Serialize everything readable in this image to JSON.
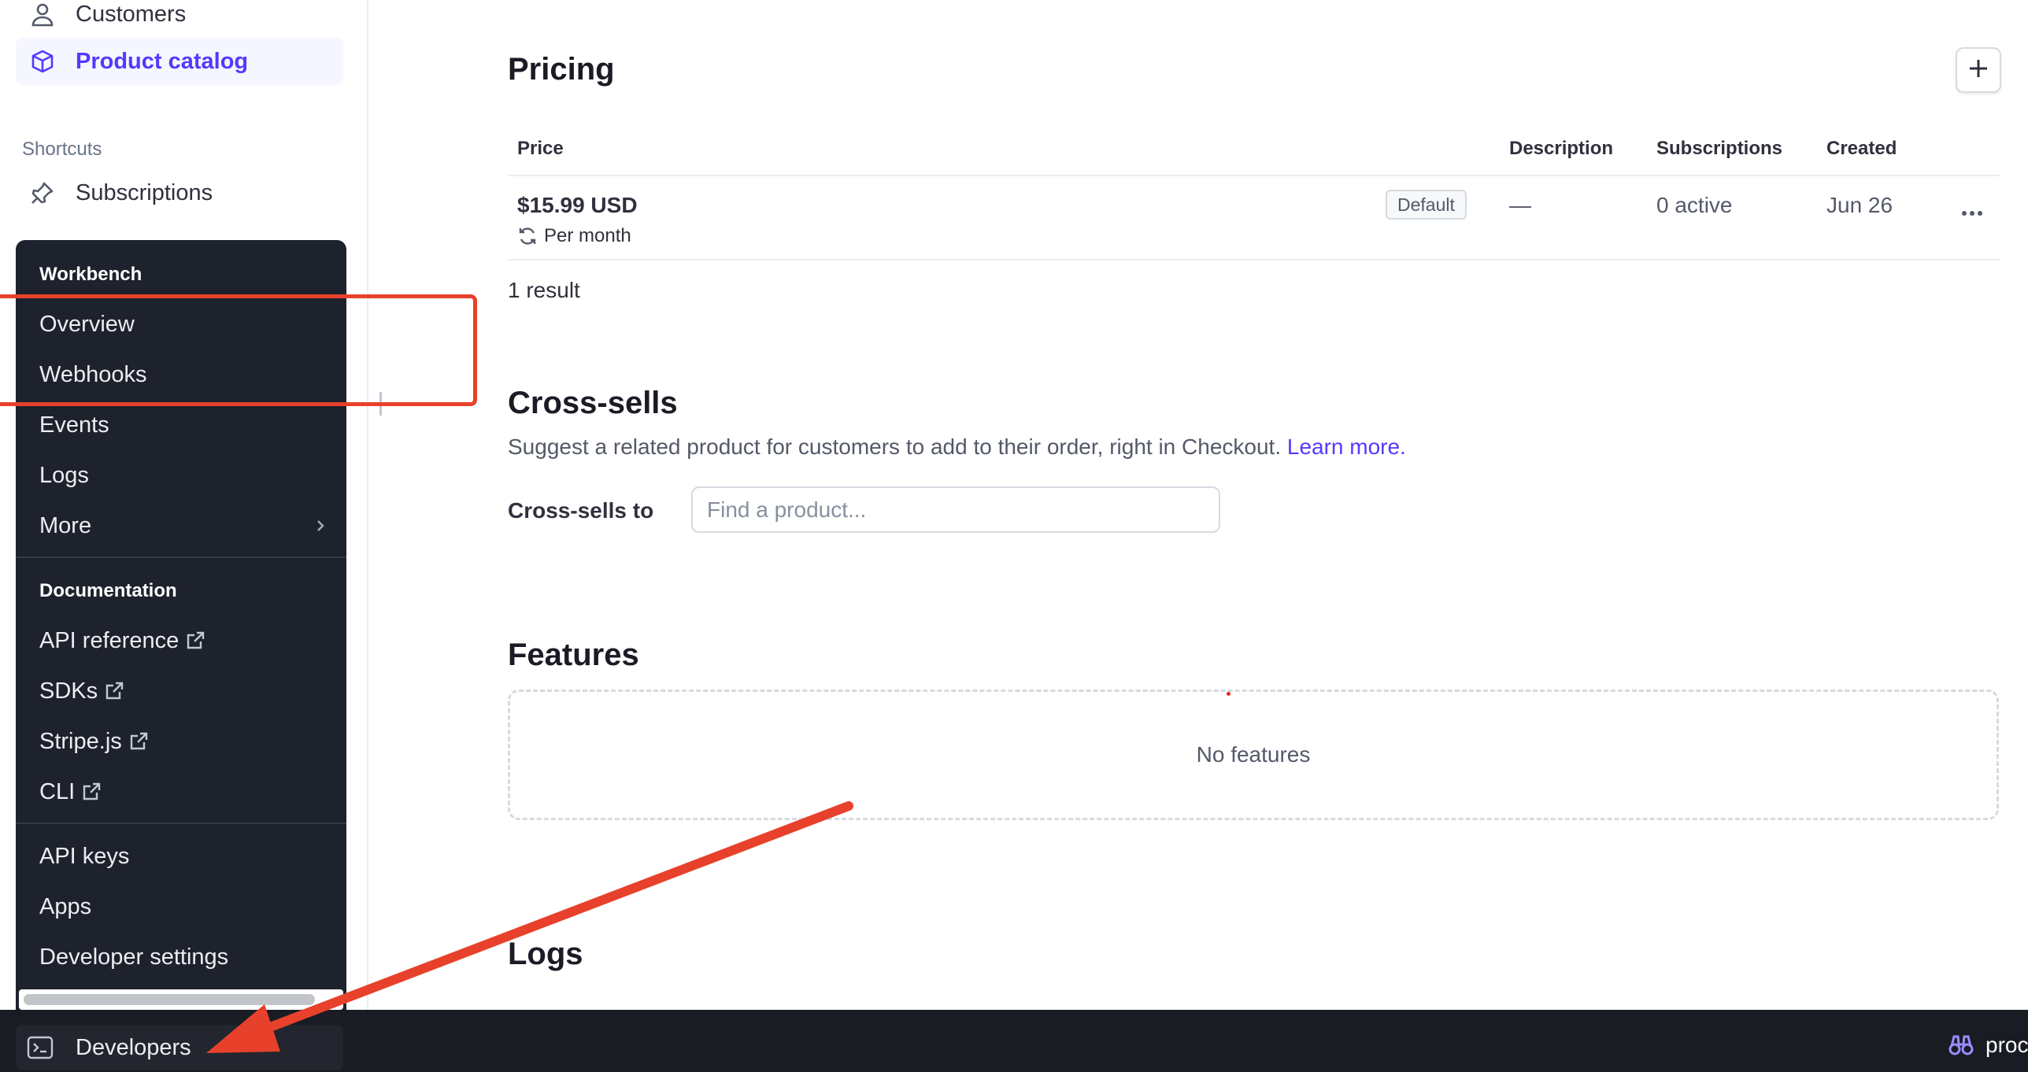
{
  "sidebar": {
    "customers": "Customers",
    "product_catalog": "Product catalog",
    "shortcuts_label": "Shortcuts",
    "subscriptions": "Subscriptions"
  },
  "dev_menu": {
    "workbench_heading": "Workbench",
    "overview": "Overview",
    "webhooks": "Webhooks",
    "events": "Events",
    "logs": "Logs",
    "more": "More",
    "documentation_heading": "Documentation",
    "api_reference": "API reference",
    "sdks": "SDKs",
    "stripe_js": "Stripe.js",
    "cli": "CLI",
    "api_keys": "API keys",
    "apps": "Apps",
    "developer_settings": "Developer settings"
  },
  "bottom_bar": {
    "developers": "Developers",
    "right_text": "proc"
  },
  "pricing": {
    "title": "Pricing",
    "columns": [
      "Price",
      "Description",
      "Subscriptions",
      "Created"
    ],
    "rows": [
      {
        "amount": "$15.99 USD",
        "interval": "Per month",
        "badge": "Default",
        "description": "—",
        "subscriptions": "0 active",
        "created": "Jun 26"
      }
    ],
    "result_count": "1 result"
  },
  "cross_sells": {
    "title": "Cross-sells",
    "description": "Suggest a related product for customers to add to their order, right in Checkout.",
    "learn_more": "Learn more.",
    "field_label": "Cross-sells to",
    "placeholder": "Find a product..."
  },
  "features": {
    "title": "Features",
    "empty_text": "No features"
  },
  "logs": {
    "title": "Logs"
  },
  "colors": {
    "accent": "#533afd",
    "annotation": "#e8412b",
    "menu_bg": "#1e222d",
    "bottom_bar_bg": "#1a1c24"
  }
}
